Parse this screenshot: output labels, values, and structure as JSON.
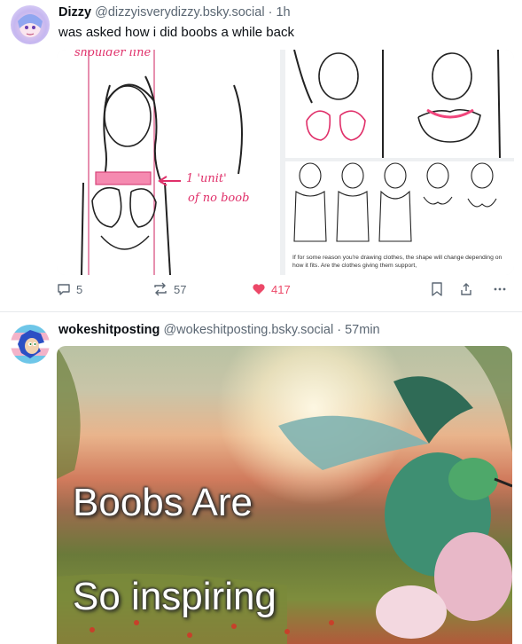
{
  "post1": {
    "author_name": "Dizzy",
    "author_handle": "@dizzyisverydizzy.bsky.social",
    "separator": "·",
    "time": "1h",
    "text": "was asked how i did boobs a while back",
    "image_labels": {
      "shoulder_line": "shoulder line",
      "unit_1": "1 'unit'",
      "unit_2": "of no boob",
      "note": "If for some reason you're drawing clothes, the shape will change depending on how it fits. Are the clothes giving them support,"
    },
    "actions": {
      "replies": "5",
      "reposts": "57",
      "likes": "417"
    }
  },
  "post2": {
    "author_name": "wokeshitposting",
    "author_handle": "@wokeshitposting.bsky.social",
    "separator": "·",
    "time": "57min",
    "meme_line1": "Boobs Are",
    "meme_line2": "So inspiring"
  },
  "colors": {
    "like": "#ec4868",
    "muted": "#5b6773",
    "sketch_accent": "#e0306a"
  }
}
